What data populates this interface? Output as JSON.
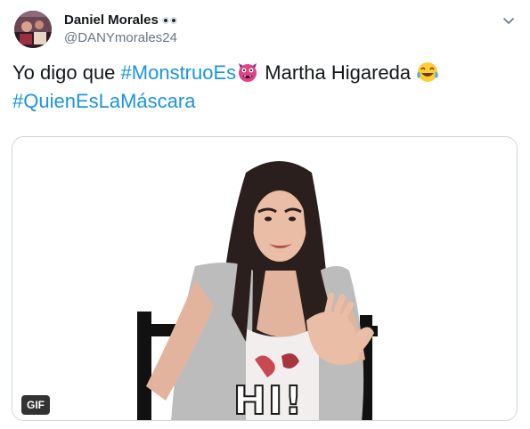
{
  "tweet": {
    "author": {
      "display_name": "Daniel Morales",
      "handle": "@DANYmorales24",
      "name_emoji": "eyes-emoji"
    },
    "menu_icon": "chevron-down-icon",
    "text": {
      "prefix": "Yo digo que ",
      "hashtag_1": "#MonstruoEs",
      "emoji_1": "pink-monster-emoji",
      "middle": " Martha Higareda ",
      "emoji_2": "tears-of-joy-emoji",
      "hashtag_2": "#QuienEsLaMáscara"
    },
    "media": {
      "badge": "GIF",
      "caption": "HI!"
    },
    "colors": {
      "hashtag": "#1b95e0",
      "handle": "#657786",
      "text": "#14171a",
      "border": "#ccd6dd"
    }
  }
}
